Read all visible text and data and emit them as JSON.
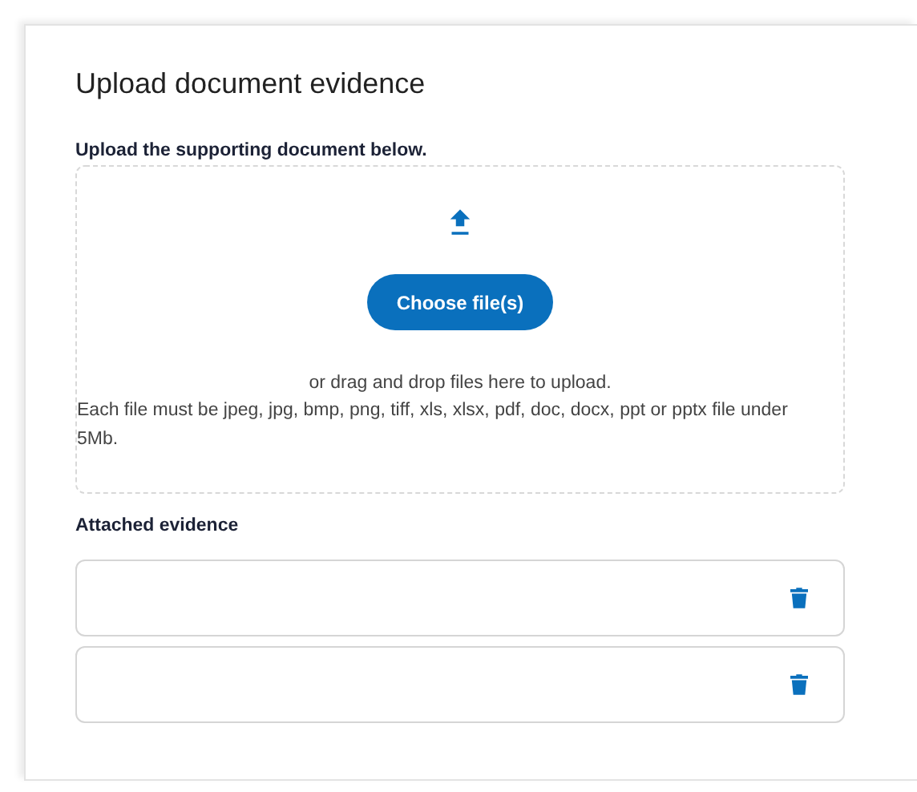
{
  "title": "Upload document evidence",
  "upload": {
    "label": "Upload the supporting document below.",
    "button": "Choose file(s)",
    "drag_text": "or drag and drop files here to upload.",
    "requirements": "Each file must be jpeg, jpg, bmp, png, tiff, xls, xlsx, pdf, doc, docx, ppt or pptx file under 5Mb."
  },
  "attached": {
    "label": "Attached evidence",
    "items": [
      {
        "kind": "file"
      },
      {
        "kind": "file"
      }
    ]
  }
}
